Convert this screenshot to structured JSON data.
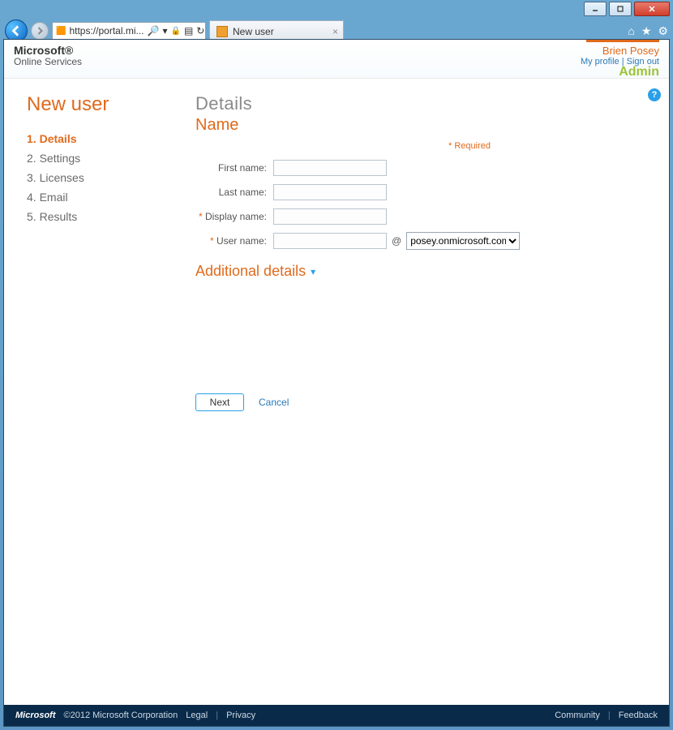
{
  "window": {
    "url_display": "https://portal.mi...",
    "search_icon": "🔍",
    "tab_title": "New user"
  },
  "header": {
    "brand_top": "Microsoft®",
    "brand_sub": "Online Services",
    "user_name": "Brien Posey",
    "profile_link": "My profile",
    "signout_link": "Sign out",
    "role": "Admin",
    "help": "?"
  },
  "page": {
    "title": "New user",
    "steps": [
      {
        "num": "1.",
        "label": "Details",
        "active": true
      },
      {
        "num": "2.",
        "label": "Settings",
        "active": false
      },
      {
        "num": "3.",
        "label": "Licenses",
        "active": false
      },
      {
        "num": "4.",
        "label": "Email",
        "active": false
      },
      {
        "num": "5.",
        "label": "Results",
        "active": false
      }
    ],
    "section_title": "Details",
    "section_sub": "Name",
    "required_note": "* Required",
    "fields": {
      "first_name_label": "First name:",
      "first_name_value": "",
      "last_name_label": "Last name:",
      "last_name_value": "",
      "display_name_label": "Display name:",
      "display_name_value": "",
      "user_name_label": "User name:",
      "user_name_value": "",
      "at": "@",
      "domain_selected": "posey.onmicrosoft.com"
    },
    "additional_details": "Additional details",
    "next_label": "Next",
    "cancel_label": "Cancel"
  },
  "footer": {
    "brand": "Microsoft",
    "copyright": "©2012 Microsoft Corporation",
    "legal": "Legal",
    "privacy": "Privacy",
    "community": "Community",
    "feedback": "Feedback"
  }
}
